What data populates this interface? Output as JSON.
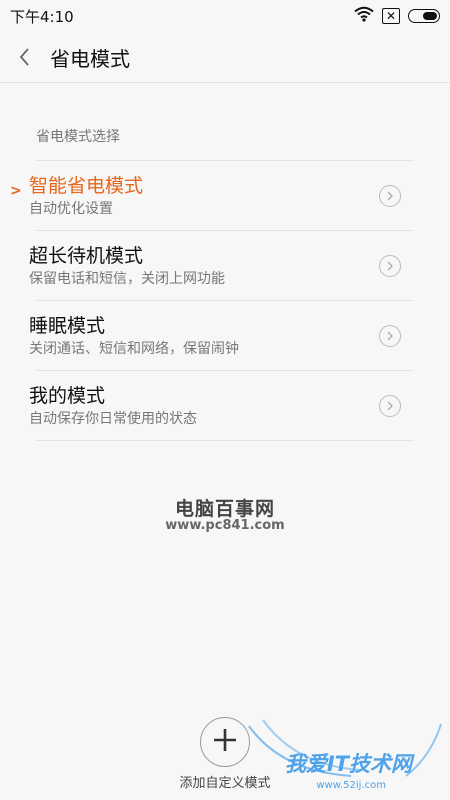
{
  "status_bar": {
    "time": "下午4:10",
    "sim_symbol": "✕",
    "battery_level": 0.55
  },
  "header": {
    "title": "省电模式"
  },
  "section": {
    "label": "省电模式选择"
  },
  "modes": [
    {
      "title": "智能省电模式",
      "subtitle": "自动优化设置",
      "selected": true
    },
    {
      "title": "超长待机模式",
      "subtitle": "保留电话和短信，关闭上网功能",
      "selected": false
    },
    {
      "title": "睡眠模式",
      "subtitle": "关闭通话、短信和网络，保留闹钟",
      "selected": false
    },
    {
      "title": "我的模式",
      "subtitle": "自动保存你日常使用的状态",
      "selected": false
    }
  ],
  "watermark": {
    "title": "电脑百事网",
    "url": "www.pc841.com"
  },
  "add_custom": {
    "label": "添加自定义模式"
  },
  "corner_watermark": {
    "text": "我爱IT技术网",
    "url": "www.52ij.com"
  },
  "colors": {
    "accent": "#e8651a",
    "background": "#f7f7f7",
    "corner_logo": "#4ea3ea"
  }
}
